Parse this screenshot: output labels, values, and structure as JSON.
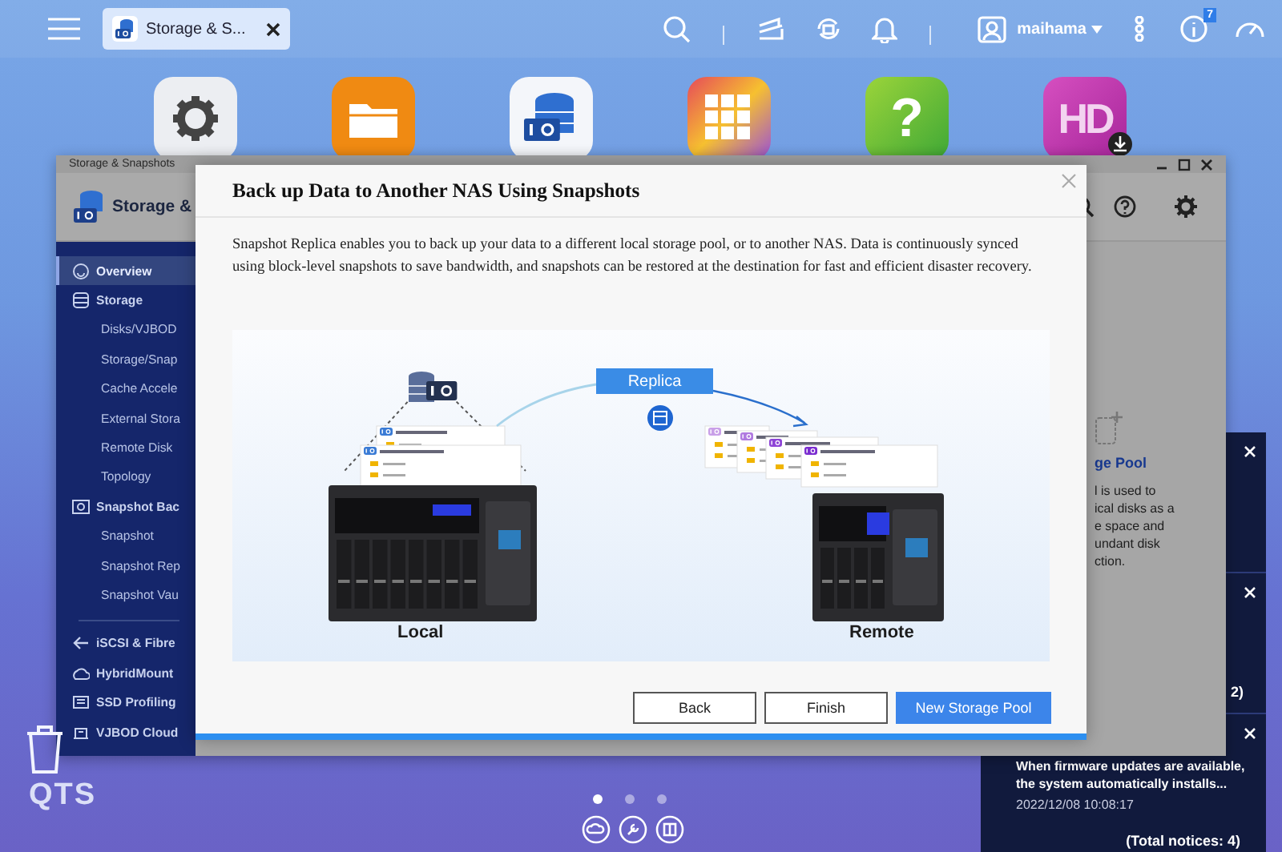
{
  "taskbar": {
    "tab": {
      "label": "Storage & S...",
      "selected": true
    },
    "user": "maihama",
    "notification_count": "7"
  },
  "desktop": {
    "app_tiles": [
      {
        "kind": "gear"
      },
      {
        "kind": "folder"
      },
      {
        "kind": "storage"
      },
      {
        "kind": "grid"
      },
      {
        "kind": "help",
        "glyph": "?"
      },
      {
        "kind": "hd",
        "glyph": "HD"
      }
    ],
    "brand": "QTS",
    "pages": [
      {
        "selected": true
      },
      {
        "selected": false
      },
      {
        "selected": false
      }
    ]
  },
  "app_window": {
    "title": "Storage & Snapshots",
    "header": "Storage &",
    "sidebar": [
      {
        "label": "Overview",
        "kind": "section",
        "selected": true
      },
      {
        "label": "Storage",
        "kind": "section",
        "selected": false
      },
      {
        "label": "Disks/VJBOD",
        "kind": "sub",
        "selected": false
      },
      {
        "label": "Storage/Snap",
        "kind": "sub",
        "selected": false
      },
      {
        "label": "Cache Accele",
        "kind": "sub",
        "selected": false
      },
      {
        "label": "External Stora",
        "kind": "sub",
        "selected": false
      },
      {
        "label": "Remote Disk",
        "kind": "sub",
        "selected": false
      },
      {
        "label": "Topology",
        "kind": "sub",
        "selected": false
      },
      {
        "label": "Snapshot Bac",
        "kind": "section",
        "selected": false
      },
      {
        "label": "Snapshot",
        "kind": "sub",
        "selected": false
      },
      {
        "label": "Snapshot Rep",
        "kind": "sub",
        "selected": false
      },
      {
        "label": "Snapshot Vau",
        "kind": "sub",
        "selected": false
      },
      {
        "label": "iSCSI & Fibre",
        "kind": "section",
        "selected": false
      },
      {
        "label": "HybridMount",
        "kind": "section",
        "selected": false
      },
      {
        "label": "SSD Profiling",
        "kind": "section",
        "selected": false
      },
      {
        "label": "VJBOD Cloud",
        "kind": "section",
        "selected": false
      }
    ],
    "panel": {
      "heading": "ge Pool",
      "lines": [
        "l is used to",
        "ical disks as a",
        "e space and",
        "undant disk",
        "ction."
      ]
    }
  },
  "dialog": {
    "title": "Back up Data to Another NAS Using Snapshots",
    "description": "Snapshot Replica enables you to back up your data to a different local storage pool, or to another NAS. Data is continuously synced using block-level snapshots to save bandwidth, and snapshots can be restored at the destination for fast and efficient disaster recovery.",
    "diagram": {
      "badge": "Replica",
      "left_label": "Local",
      "right_label": "Remote"
    },
    "buttons": [
      {
        "label": "Back",
        "kind": "secondary"
      },
      {
        "label": "Finish",
        "kind": "secondary"
      },
      {
        "label": "New Storage Pool",
        "kind": "primary"
      }
    ]
  },
  "notifications": {
    "partial_text": "2)",
    "message": "When firmware updates are available, the system automatically installs...",
    "time": "2022/12/08 10:08:17",
    "total": "(Total notices: 4)"
  }
}
